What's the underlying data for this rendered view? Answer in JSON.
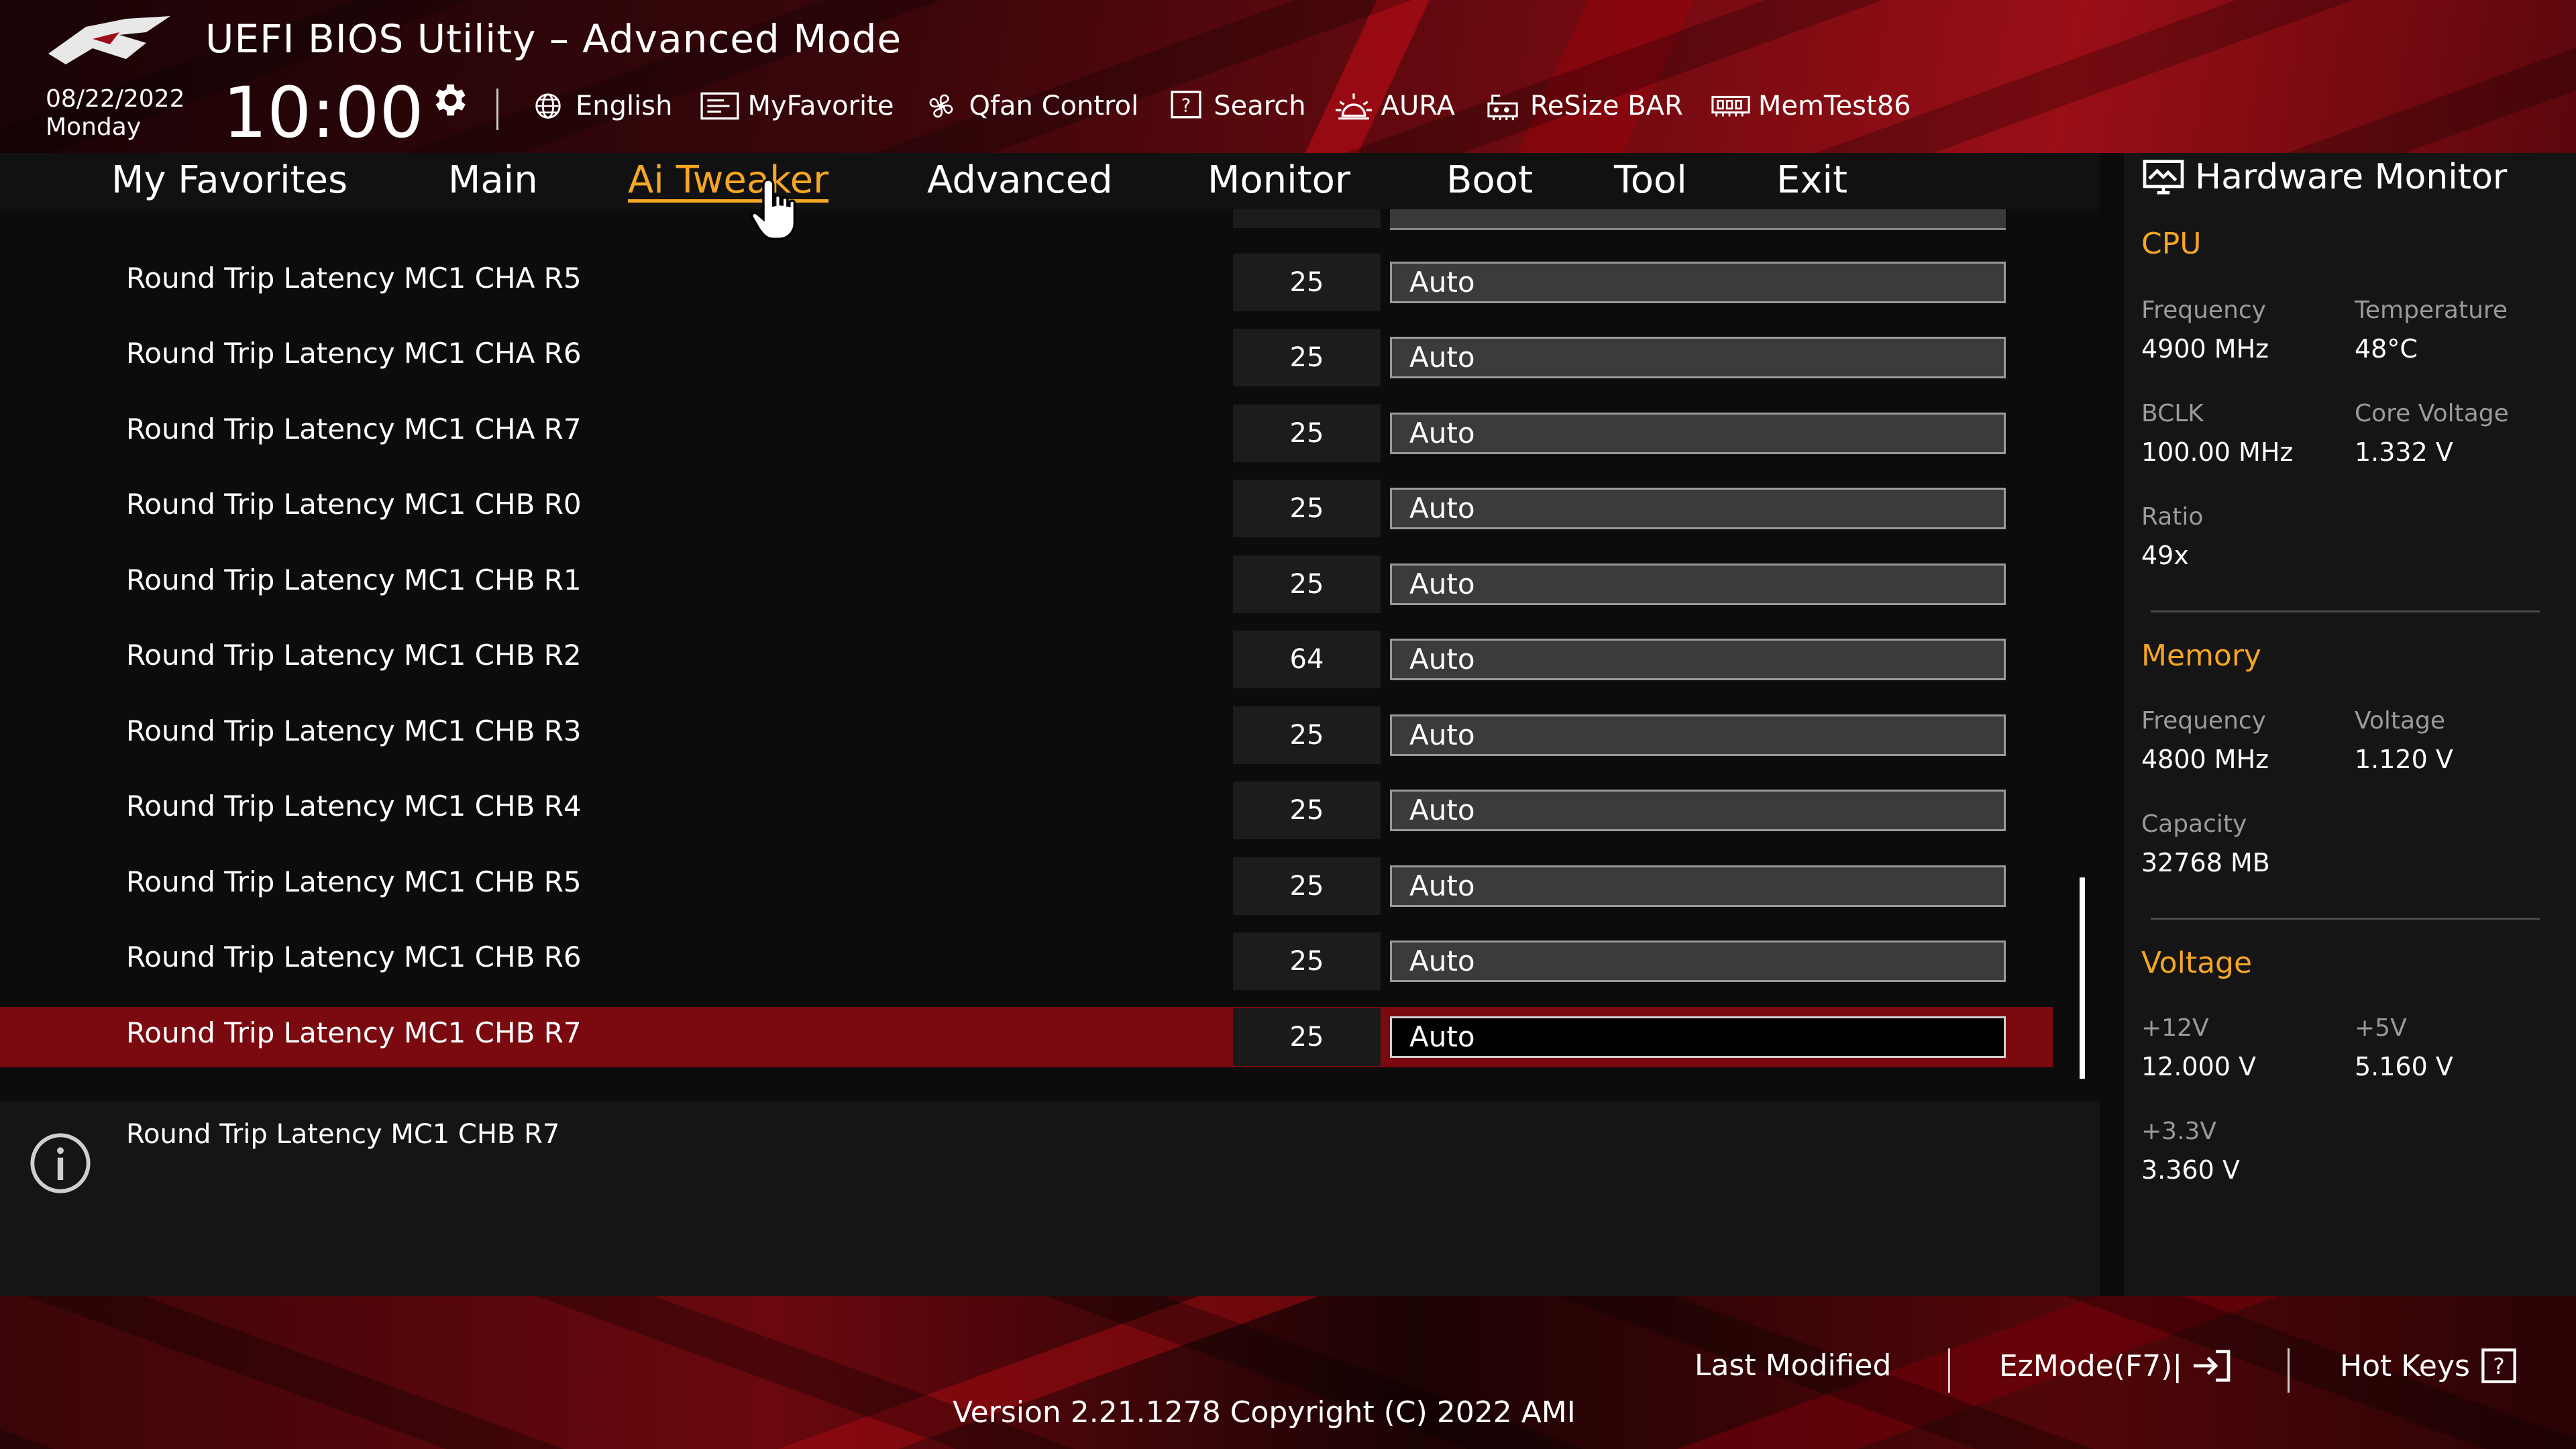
{
  "header": {
    "title": "UEFI BIOS Utility – Advanced Mode",
    "date": "08/22/2022",
    "day": "Monday",
    "time": "10:00",
    "toolbar": [
      {
        "label": "English",
        "icon": "globe-icon"
      },
      {
        "label": "MyFavorite",
        "icon": "favorite-icon"
      },
      {
        "label": "Qfan Control",
        "icon": "fan-icon"
      },
      {
        "label": "Search",
        "icon": "search-icon"
      },
      {
        "label": "AURA",
        "icon": "aura-icon"
      },
      {
        "label": "ReSize BAR",
        "icon": "resize-bar-icon"
      },
      {
        "label": "MemTest86",
        "icon": "memtest-icon"
      }
    ]
  },
  "nav": {
    "tabs": [
      "My Favorites",
      "Main",
      "Ai Tweaker",
      "Advanced",
      "Monitor",
      "Boot",
      "Tool",
      "Exit"
    ],
    "active": "Ai Tweaker"
  },
  "settings": [
    {
      "label": "Round Trip Latency MC1 CHA R5",
      "current": "25",
      "value": "Auto"
    },
    {
      "label": "Round Trip Latency MC1 CHA R6",
      "current": "25",
      "value": "Auto"
    },
    {
      "label": "Round Trip Latency MC1 CHA R7",
      "current": "25",
      "value": "Auto"
    },
    {
      "label": "Round Trip Latency MC1 CHB R0",
      "current": "25",
      "value": "Auto"
    },
    {
      "label": "Round Trip Latency MC1 CHB R1",
      "current": "25",
      "value": "Auto"
    },
    {
      "label": "Round Trip Latency MC1 CHB R2",
      "current": "64",
      "value": "Auto"
    },
    {
      "label": "Round Trip Latency MC1 CHB R3",
      "current": "25",
      "value": "Auto"
    },
    {
      "label": "Round Trip Latency MC1 CHB R4",
      "current": "25",
      "value": "Auto"
    },
    {
      "label": "Round Trip Latency MC1 CHB R5",
      "current": "25",
      "value": "Auto"
    },
    {
      "label": "Round Trip Latency MC1 CHB R6",
      "current": "25",
      "value": "Auto"
    },
    {
      "label": "Round Trip Latency MC1 CHB R7",
      "current": "25",
      "value": "Auto",
      "selected": true
    }
  ],
  "info": {
    "text": "Round Trip Latency MC1 CHB R7"
  },
  "hardware_monitor": {
    "title": "Hardware Monitor",
    "cpu": {
      "heading": "CPU",
      "frequency_label": "Frequency",
      "frequency": "4900 MHz",
      "temperature_label": "Temperature",
      "temperature": "48°C",
      "bclk_label": "BCLK",
      "bclk": "100.00 MHz",
      "core_voltage_label": "Core Voltage",
      "core_voltage": "1.332 V",
      "ratio_label": "Ratio",
      "ratio": "49x"
    },
    "memory": {
      "heading": "Memory",
      "frequency_label": "Frequency",
      "frequency": "4800 MHz",
      "voltage_label": "Voltage",
      "voltage": "1.120 V",
      "capacity_label": "Capacity",
      "capacity": "32768 MB"
    },
    "voltage": {
      "heading": "Voltage",
      "v12_label": "+12V",
      "v12": "12.000 V",
      "v5_label": "+5V",
      "v5": "5.160 V",
      "v33_label": "+3.3V",
      "v33": "3.360 V"
    }
  },
  "footer": {
    "last_modified": "Last Modified",
    "ezmode": "EzMode(F7)|",
    "hotkeys": "Hot Keys",
    "version": "Version 2.21.1278 Copyright (C) 2022 AMI"
  },
  "colors": {
    "accent": "#f5a623",
    "selected_row": "#7a0a10",
    "brand_red": "#9a0e16"
  }
}
